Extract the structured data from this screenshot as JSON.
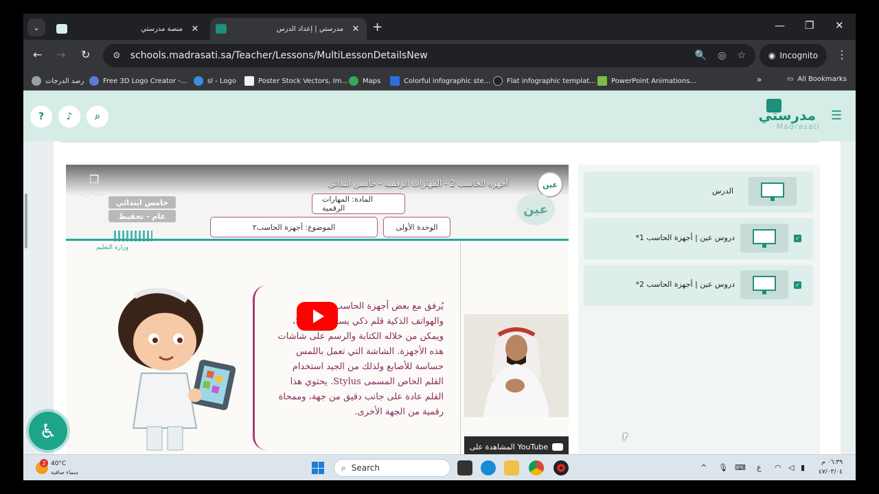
{
  "browser": {
    "tabs": [
      {
        "title": "منصة مدرستي",
        "active": false
      },
      {
        "title": "مدرستي | إعداد الدرس",
        "active": true
      }
    ],
    "url": "schools.madrasati.sa/Teacher/Lessons/MultiLessonDetailsNew",
    "incognito_label": "Incognito",
    "bookmarks": [
      "رصد الدرجات",
      "Free 3D Logo Creator -...",
      "sl - Logo",
      "Poster Stock Vectors, Im...",
      "Maps",
      "Colorful infographic ste...",
      "Flat infographic templat...",
      "PowerPoint Animations..."
    ],
    "all_bookmarks_label": "All Bookmarks"
  },
  "site": {
    "logo_ar": "مدرستي",
    "logo_en": "Madrasati"
  },
  "video": {
    "title": "أجهزة الحاسب 2 - المهارات الرقمية - خامس ابتدائي",
    "copy_label": "نسخ الرابط",
    "channel": "عين",
    "subject": "المادة: المهارات الرقمية",
    "unit": "الوحدة الأولى",
    "topic": "الموضوع: أجهزة الحاسب٢",
    "grade1": "خامس ابتدائي",
    "grade2": "عام - تحفيظ",
    "ministry": "وزارة التعليم",
    "passage": "يُرفق مع بعض أجهزة الحاسب اللوحية والهواتف الذكية قلم ذكي يسمى Stylus، ويمكن من خلاله الكتابة والرسم على شاشات هذه الأجهزة. الشاشة التي تعمل باللمس حساسة للأصابع ولذلك من الجيد استخدام القلم الخاص المسمى Stylus. يحتوي هذا القلم عادة على جانب دقيق من جهة، وممحاة رقمية من الجهة الأخرى.",
    "watch_on": "المشاهدة على YouTube"
  },
  "lessons": [
    {
      "label": "الدرس",
      "checked": false
    },
    {
      "label": "دروس عين | أجهزة الحاسب 1*",
      "checked": true
    },
    {
      "label": "دروس عين | أجهزة الحاسب 2*",
      "checked": true
    }
  ],
  "taskbar": {
    "weather_temp": "40°C",
    "weather_cond": "سماء صافية",
    "weather_alerts": "2",
    "search_label": "Search",
    "lang": "ع",
    "time": "٠٦:٣٩ م",
    "date": "٤٧/٠٣/٠٤"
  },
  "colors": {
    "brand": "#1d8f7a",
    "header_bg": "#d5ede6",
    "passage_text": "#8a2a5d"
  }
}
